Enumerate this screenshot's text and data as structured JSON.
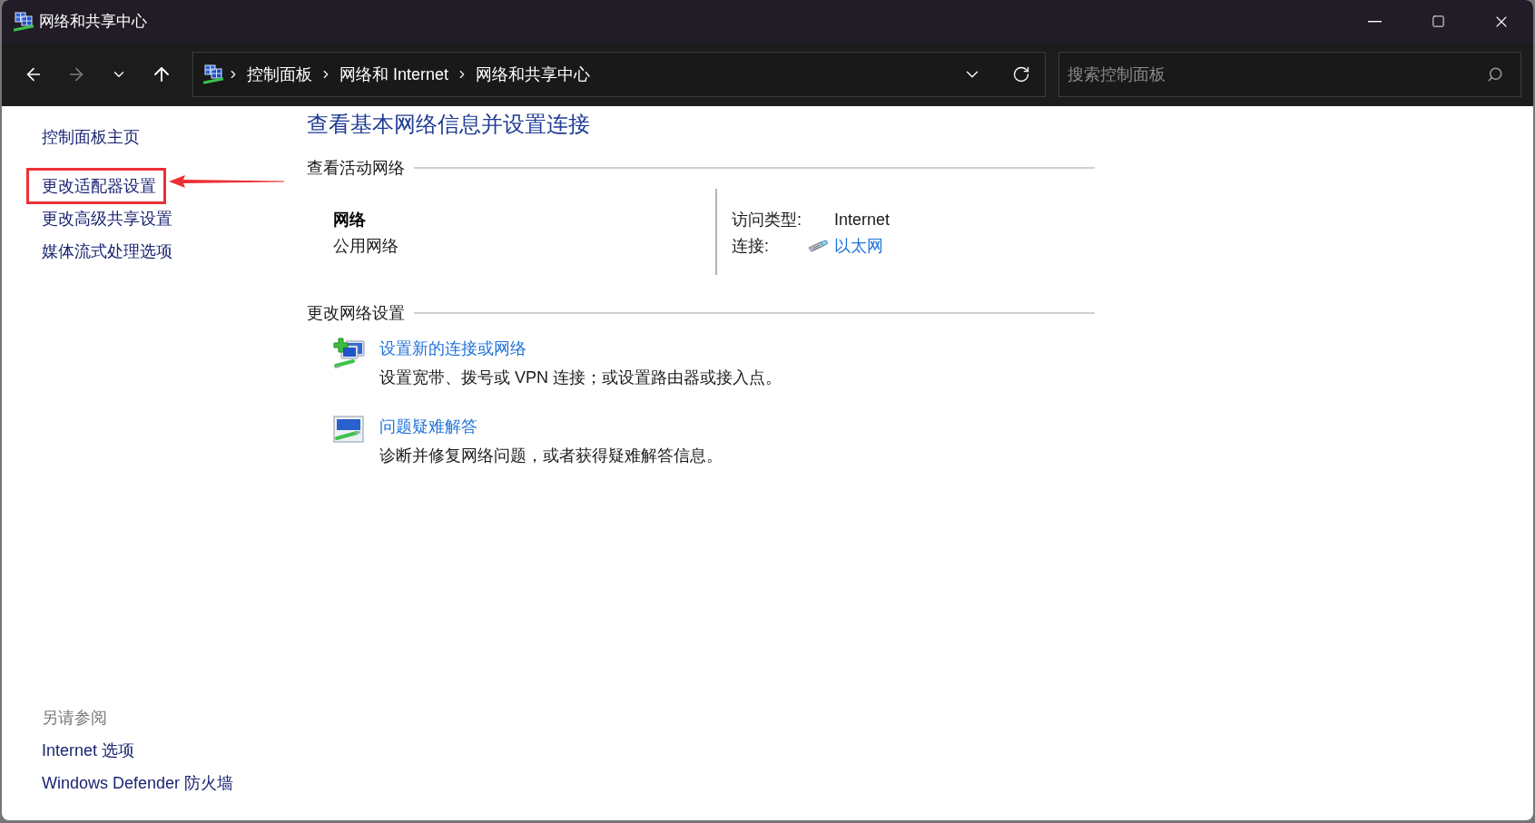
{
  "window": {
    "title": "网络和共享中心"
  },
  "nav_buttons": [
    {
      "kind": "back",
      "disabled": false
    },
    {
      "kind": "forward",
      "disabled": true
    },
    {
      "kind": "recent",
      "disabled": false
    },
    {
      "kind": "up",
      "disabled": false
    }
  ],
  "address_bar": {
    "breadcrumbs": [
      "控制面板",
      "网络和 Internet",
      "网络和共享中心"
    ]
  },
  "search": {
    "placeholder": "搜索控制面板"
  },
  "sidebar": {
    "items": [
      {
        "label": "控制面板主页",
        "highlighted": false
      },
      {
        "label": "更改适配器设置",
        "highlighted": true
      },
      {
        "label": "更改高级共享设置",
        "highlighted": false
      },
      {
        "label": "媒体流式处理选项",
        "highlighted": false
      }
    ],
    "see_also": {
      "title": "另请参阅",
      "links": [
        "Internet 选项",
        "Windows Defender 防火墙"
      ]
    }
  },
  "main": {
    "title": "查看基本网络信息并设置连接",
    "active_networks": {
      "heading": "查看活动网络",
      "network": {
        "name": "网络",
        "category": "公用网络",
        "access_type_label": "访问类型:",
        "access_type": "Internet",
        "connections_label": "连接:",
        "connection": "以太网"
      }
    },
    "change_settings": {
      "heading": "更改网络设置",
      "tasks": [
        {
          "kind": "new-connection",
          "title": "设置新的连接或网络",
          "description": "设置宽带、拨号或 VPN 连接；或设置路由器或接入点。"
        },
        {
          "kind": "troubleshoot",
          "title": "问题疑难解答",
          "description": "诊断并修复网络问题，或者获得疑难解答信息。"
        }
      ]
    }
  }
}
